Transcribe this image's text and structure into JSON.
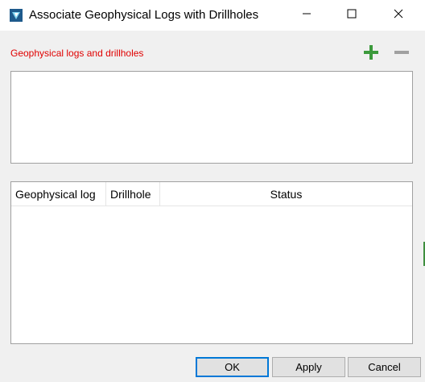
{
  "window": {
    "title": "Associate Geophysical Logs with Drillholes",
    "app_icon": "app-logo-icon",
    "controls": {
      "minimize": "minimize-icon",
      "maximize": "maximize-icon",
      "close": "close-icon"
    }
  },
  "section": {
    "label": "Geophysical logs and drillholes",
    "add_icon": "plus-icon",
    "remove_icon": "minus-icon",
    "colors": {
      "label": "#e00000",
      "add": "#3c9a3c",
      "remove": "#a0a0a0"
    }
  },
  "table": {
    "columns": [
      "Geophysical log",
      "Drillhole",
      "Status"
    ],
    "rows": []
  },
  "buttons": {
    "ok": "OK",
    "apply": "Apply",
    "cancel": "Cancel"
  }
}
